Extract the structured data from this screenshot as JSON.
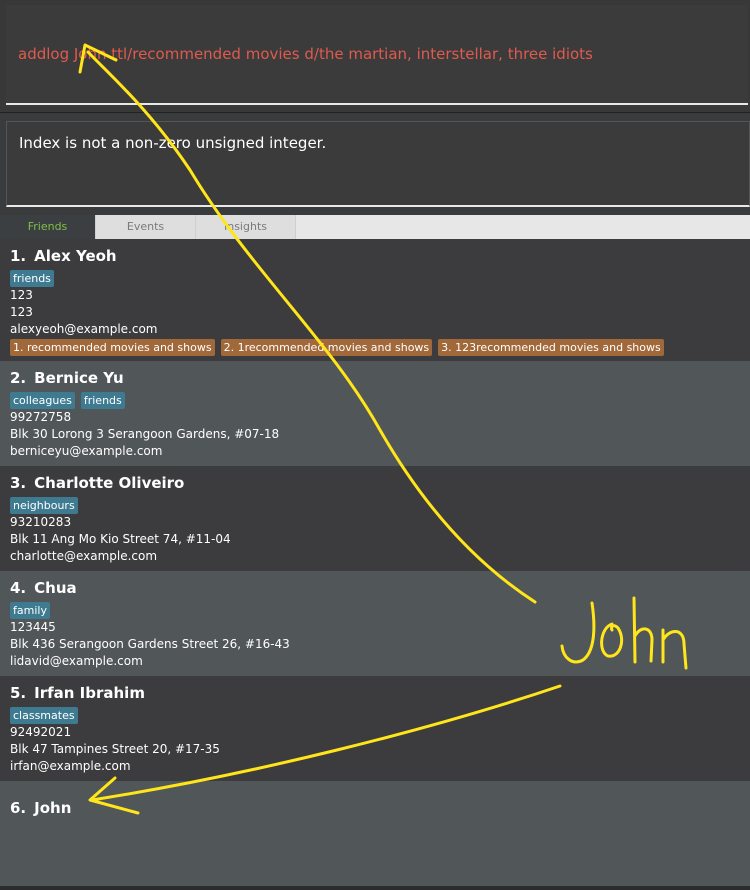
{
  "command": {
    "value": "addlog John ttl/recommended movies d/the martian, interstellar, three idiots"
  },
  "result": {
    "message": "Index is not a non-zero unsigned integer."
  },
  "tabs": [
    {
      "label": "Friends"
    },
    {
      "label": "Events"
    },
    {
      "label": "Insights"
    }
  ],
  "persons": [
    {
      "index": "1.",
      "name": "Alex Yeoh",
      "tags": [
        "friends"
      ],
      "phone": "123",
      "address": "123",
      "email": "alexyeoh@example.com",
      "logs": [
        "1. recommended movies and shows",
        "2. 1recommended movies and shows",
        "3. 123recommended movies and shows"
      ]
    },
    {
      "index": "2.",
      "name": "Bernice Yu",
      "tags": [
        "colleagues",
        "friends"
      ],
      "phone": "99272758",
      "address": "Blk 30 Lorong 3 Serangoon Gardens, #07-18",
      "email": "berniceyu@example.com",
      "logs": []
    },
    {
      "index": "3.",
      "name": "Charlotte Oliveiro",
      "tags": [
        "neighbours"
      ],
      "phone": "93210283",
      "address": "Blk 11 Ang Mo Kio Street 74, #11-04",
      "email": "charlotte@example.com",
      "logs": []
    },
    {
      "index": "4.",
      "name": "Chua",
      "tags": [
        "family"
      ],
      "phone": "123445",
      "address": "Blk 436 Serangoon Gardens Street 26, #16-43",
      "email": "lidavid@example.com",
      "logs": []
    },
    {
      "index": "5.",
      "name": "Irfan Ibrahim",
      "tags": [
        "classmates"
      ],
      "phone": "92492021",
      "address": "Blk 47 Tampines Street 20, #17-35",
      "email": "irfan@example.com",
      "logs": []
    },
    {
      "index": "6.",
      "name": "John",
      "tags": [],
      "phone": "",
      "address": "",
      "email": "",
      "logs": []
    }
  ],
  "annotation": {
    "handwritten_text": "John",
    "color": "#ffe51a"
  },
  "colors": {
    "command_text": "#e05a4e",
    "tag_bg": "#3e7b91",
    "log_bg": "#a1683a",
    "active_tab_text": "#7fbf4a"
  }
}
